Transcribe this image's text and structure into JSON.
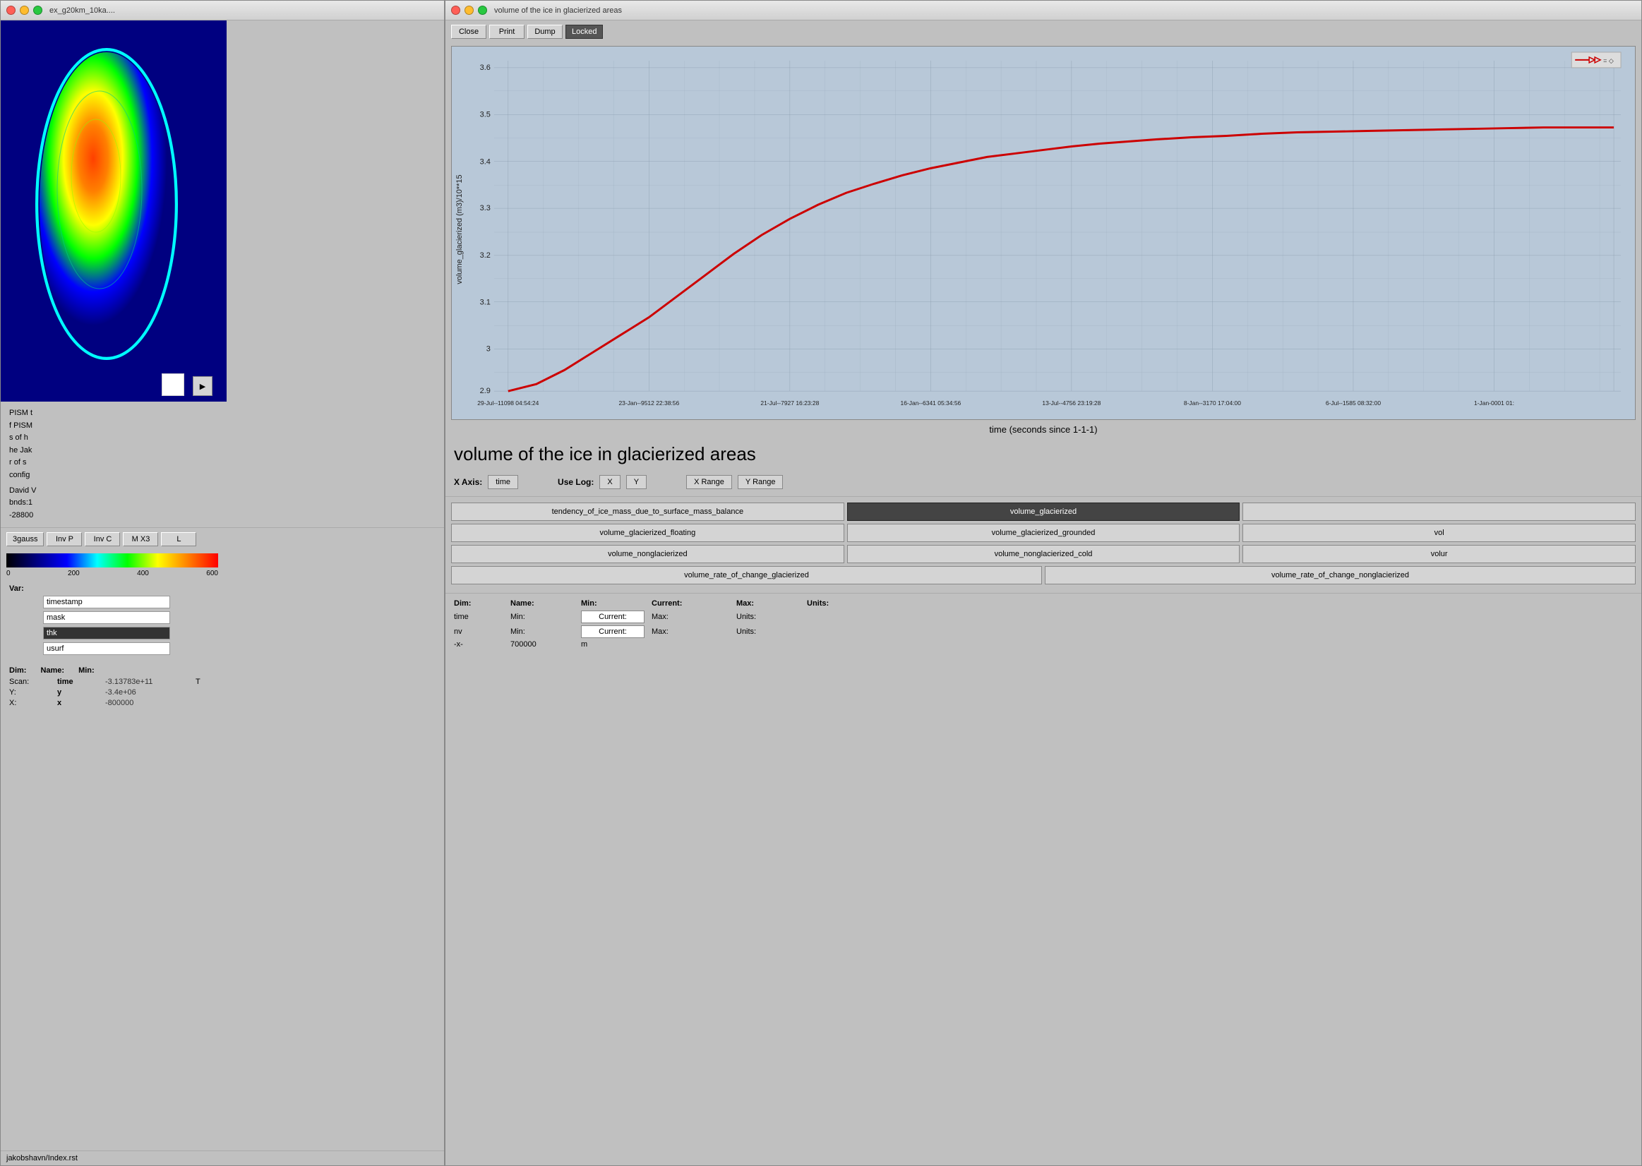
{
  "left_window": {
    "title": "ex_g20km_10ka....",
    "map_placeholder": "colormap ice visualization",
    "info_lines": [
      "PISM t",
      "",
      "f PISM",
      "",
      "s of h",
      "he Jak",
      "r of s",
      "config"
    ],
    "author": "David V",
    "coords": "bnds:1",
    "value": "-28800",
    "toolbar_buttons": [
      "3gauss",
      "Inv P",
      "Inv C",
      "M X3",
      "L"
    ],
    "colorbar_min": "0",
    "colorbar_mid1": "200",
    "colorbar_mid2": "400",
    "colorbar_max": "600",
    "var_label": "Var:",
    "var_fields": [
      "timestamp",
      "mask",
      "thk",
      "usurf"
    ],
    "var_active": "thk",
    "dim_label": "Dim:",
    "dim_name_label": "Name:",
    "dim_min_label": "Min:",
    "dim_rows": [
      {
        "label": "Scan:",
        "name": "time",
        "min": "-3.13783e+11",
        "extra": "T"
      },
      {
        "label": "Y:",
        "name": "y",
        "min": "-3.4e+06",
        "extra": ""
      },
      {
        "label": "X:",
        "name": "x",
        "min": "-800000",
        "extra": ""
      }
    ],
    "bottom_text": "jakobshavn/Index.rst"
  },
  "right_window": {
    "title": "volume of the ice in glacierized areas",
    "close_btn": "Close",
    "print_btn": "Print",
    "dump_btn": "Dump",
    "locked_btn": "Locked",
    "chart_title": "volume of the ice in glacierized areas",
    "x_axis_title": "time (seconds since 1-1-1)",
    "y_axis_label": "volume_glacierized (m3)/10**15",
    "y_min": "2.9",
    "y_max": "3.6",
    "y_ticks": [
      "3.6",
      "",
      "3.5",
      "",
      "3.4",
      "",
      "3.3",
      "",
      "3.2",
      "",
      "3.1",
      "",
      "3",
      "",
      "2.9"
    ],
    "x_ticks": [
      "29-Jul--11098 04:54:24",
      "23-Jan--9512 22:38:56",
      "21-Jul--7927 16:23:28",
      "16-Jan--6341 05:34:56",
      "13-Jul--4756 23:19:28",
      "8-Jan--3170 17:04:00",
      "6-Jul--1585 08:32:00",
      "1-Jan-0001 01:"
    ],
    "axis_x_label": "X Axis:",
    "axis_x_value": "time",
    "use_log_label": "Use Log:",
    "log_x_btn": "X",
    "log_y_btn": "Y",
    "x_range_btn": "X Range",
    "y_range_btn": "Y Range",
    "var_buttons": [
      {
        "label": "tendency_of_ice_mass_due_to_surface_mass_balance",
        "active": false
      },
      {
        "label": "volume_glacierized",
        "active": true
      },
      {
        "label": "",
        "active": false
      },
      {
        "label": "volume_glacierized_floating",
        "active": false
      },
      {
        "label": "volume_glacierized_grounded",
        "active": false
      },
      {
        "label": "vol",
        "active": false
      },
      {
        "label": "volume_nonglacierized",
        "active": false
      },
      {
        "label": "volume_nonglacierized_cold",
        "active": false
      },
      {
        "label": "volur",
        "active": false
      },
      {
        "label": "volume_rate_of_change_glacierized",
        "active": false
      },
      {
        "label": "volume_rate_of_change_nonglacierized",
        "active": false
      }
    ],
    "dim_header": {
      "dim": "Dim:",
      "name": "Name:",
      "min": "Min:",
      "current": "Current:",
      "max": "Max:",
      "units": "Units:"
    },
    "dim_rows": [
      {
        "dim": "time",
        "min": "Min:",
        "current_btn": "Current:",
        "max": "Max:",
        "units": "Units:"
      },
      {
        "dim": "nv",
        "min": "Min:",
        "current_btn": "Current:",
        "max": "Max:",
        "units": "Units:"
      },
      {
        "dim": "-x-",
        "min": "700000",
        "extra": "m"
      }
    ]
  }
}
